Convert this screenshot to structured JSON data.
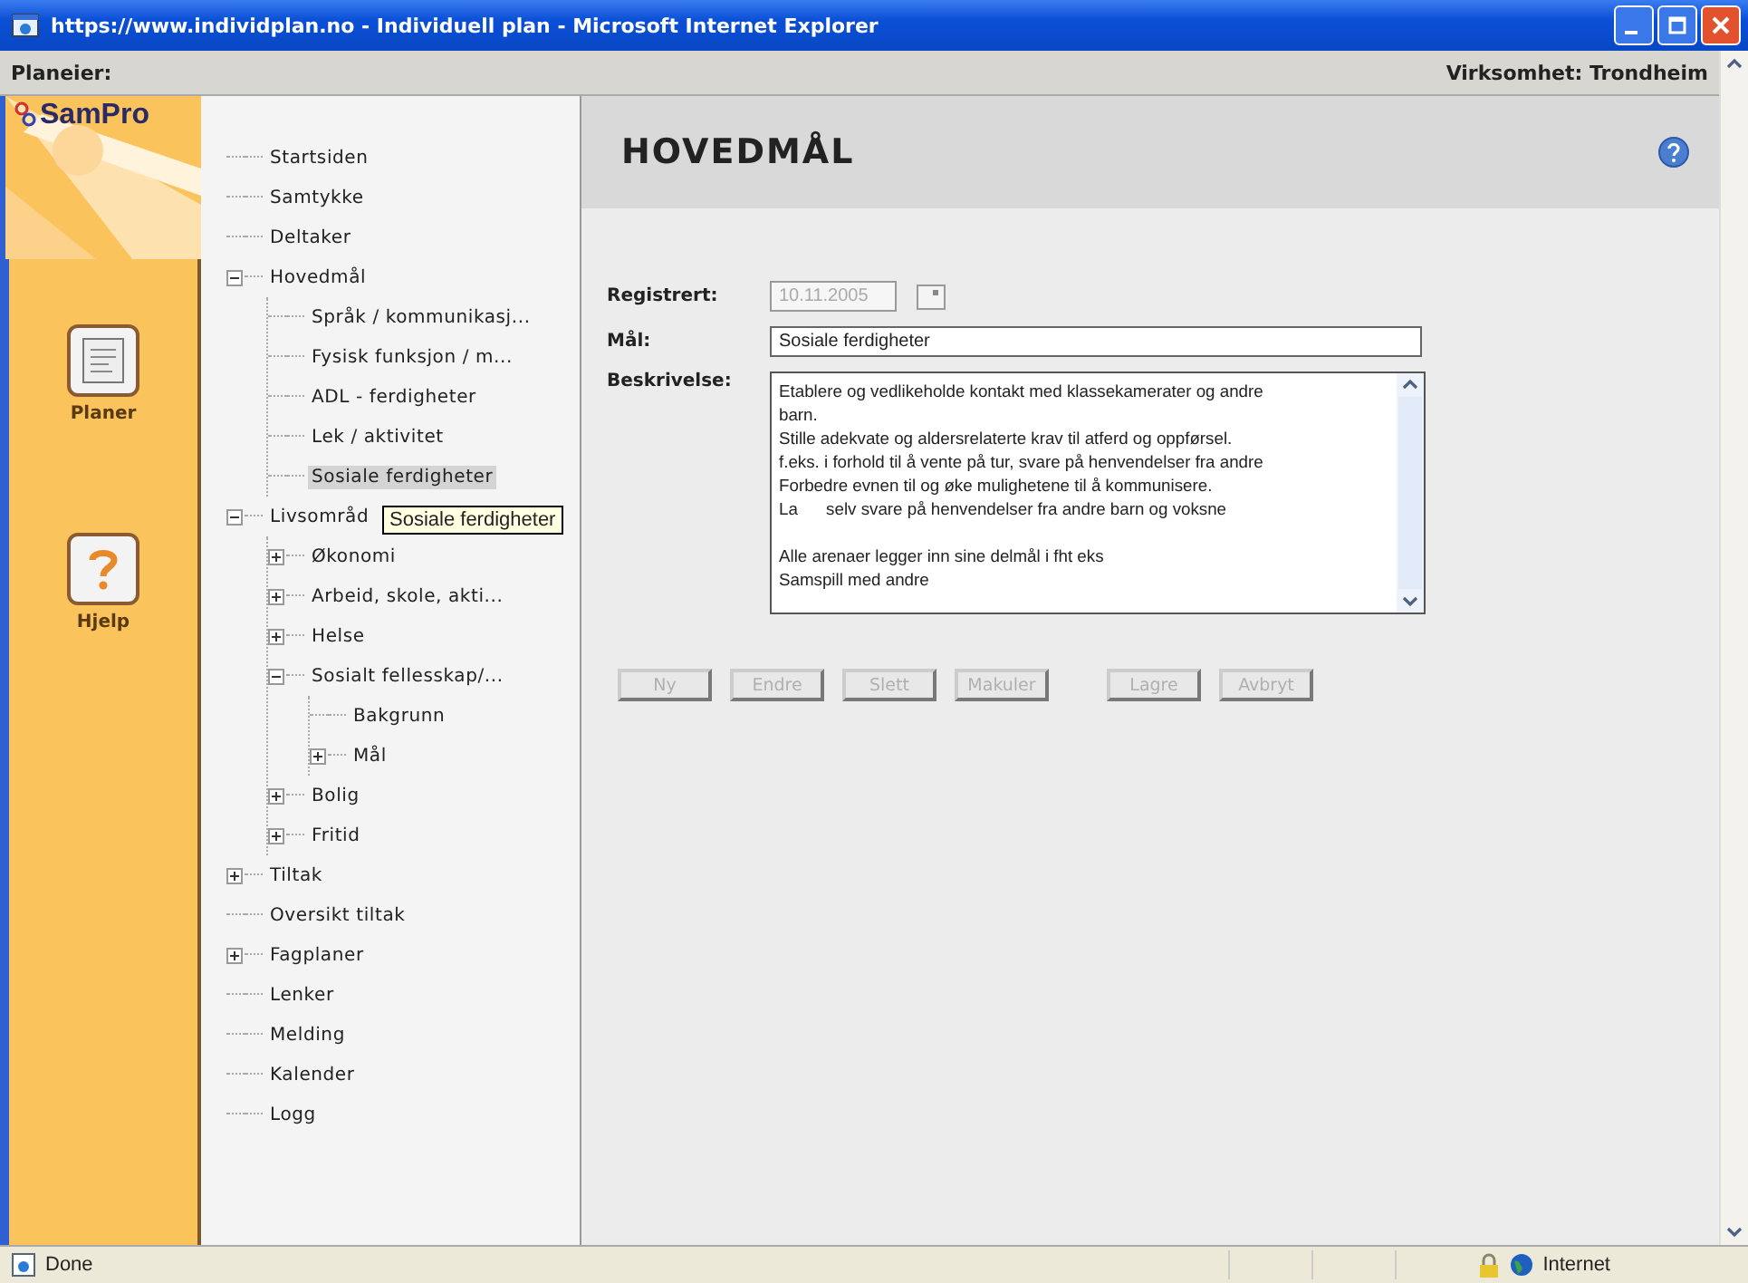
{
  "window": {
    "title": "https://www.individplan.no - Individuell plan - Microsoft Internet Explorer"
  },
  "header": {
    "left": "Planeier:",
    "right": "Virksomhet: Trondheim"
  },
  "rail": {
    "logo": "SamPro",
    "items": [
      {
        "kind": "plans",
        "label": "Planer"
      },
      {
        "kind": "help",
        "label": "Hjelp"
      }
    ]
  },
  "tree": [
    {
      "label": "Startsiden",
      "selected": false
    },
    {
      "label": "Samtykke",
      "selected": false
    },
    {
      "label": "Deltaker",
      "selected": false
    },
    {
      "label": "Hovedmål",
      "selected": false,
      "expanded": true,
      "children": [
        {
          "label": "Språk / kommunikasj...",
          "selected": false
        },
        {
          "label": "Fysisk funksjon / m...",
          "selected": false
        },
        {
          "label": "ADL - ferdigheter",
          "selected": false
        },
        {
          "label": "Lek / aktivitet",
          "selected": false
        },
        {
          "label": "Sosiale ferdigheter",
          "selected": true
        }
      ]
    },
    {
      "label": "Livsområd",
      "selected": false,
      "expanded": true,
      "children": [
        {
          "label": "Økonomi",
          "selected": false,
          "expanded": false
        },
        {
          "label": "Arbeid, skole, akti...",
          "selected": false,
          "expanded": false
        },
        {
          "label": "Helse",
          "selected": false,
          "expanded": false
        },
        {
          "label": "Sosialt fellesskap/...",
          "selected": false,
          "expanded": true,
          "children": [
            {
              "label": "Bakgrunn",
              "selected": false
            },
            {
              "label": "Mål",
              "selected": false,
              "expanded": false
            }
          ]
        },
        {
          "label": "Bolig",
          "selected": false,
          "expanded": false
        },
        {
          "label": "Fritid",
          "selected": false,
          "expanded": false
        }
      ]
    },
    {
      "label": "Tiltak",
      "selected": false,
      "expanded": false
    },
    {
      "label": "Oversikt tiltak",
      "selected": false
    },
    {
      "label": "Fagplaner",
      "selected": false,
      "expanded": false
    },
    {
      "label": "Lenker",
      "selected": false
    },
    {
      "label": "Melding",
      "selected": false
    },
    {
      "label": "Kalender",
      "selected": false
    },
    {
      "label": "Logg",
      "selected": false
    }
  ],
  "tooltip": "Sosiale ferdigheter",
  "main": {
    "title": "HOVEDMÅL",
    "registered": {
      "label": "Registrert:",
      "value": "10.11.2005",
      "disabled": true
    },
    "goal": {
      "label": "Mål:",
      "value": "Sosiale ferdigheter"
    },
    "description": {
      "label": "Beskrivelse:",
      "paragraphs": [
        [
          "Etablere og vedlikeholde kontakt med klassekamerater og andre",
          "barn.",
          "Stille adekvate og aldersrelaterte krav til atferd og oppførsel.",
          "f.eks. i forhold til å vente på tur, svare på henvendelser fra andre",
          "Forbedre evnen til og øke mulighetene til å kommunisere.",
          "La      selv svare på henvendelser fra andre barn og voksne"
        ],
        [
          "Alle arenaer legger inn sine delmål i fht eks",
          "Samspill med andre"
        ]
      ]
    },
    "button_groups": [
      [
        {
          "label": "Ny",
          "disabled": true
        },
        {
          "label": "Endre",
          "disabled": true
        },
        {
          "label": "Slett",
          "disabled": true
        },
        {
          "label": "Makuler",
          "disabled": true
        }
      ],
      [
        {
          "label": "Lagre",
          "disabled": true
        },
        {
          "label": "Avbryt",
          "disabled": true
        }
      ]
    ]
  },
  "status_bar": {
    "status": "Done",
    "zone": "Internet"
  }
}
